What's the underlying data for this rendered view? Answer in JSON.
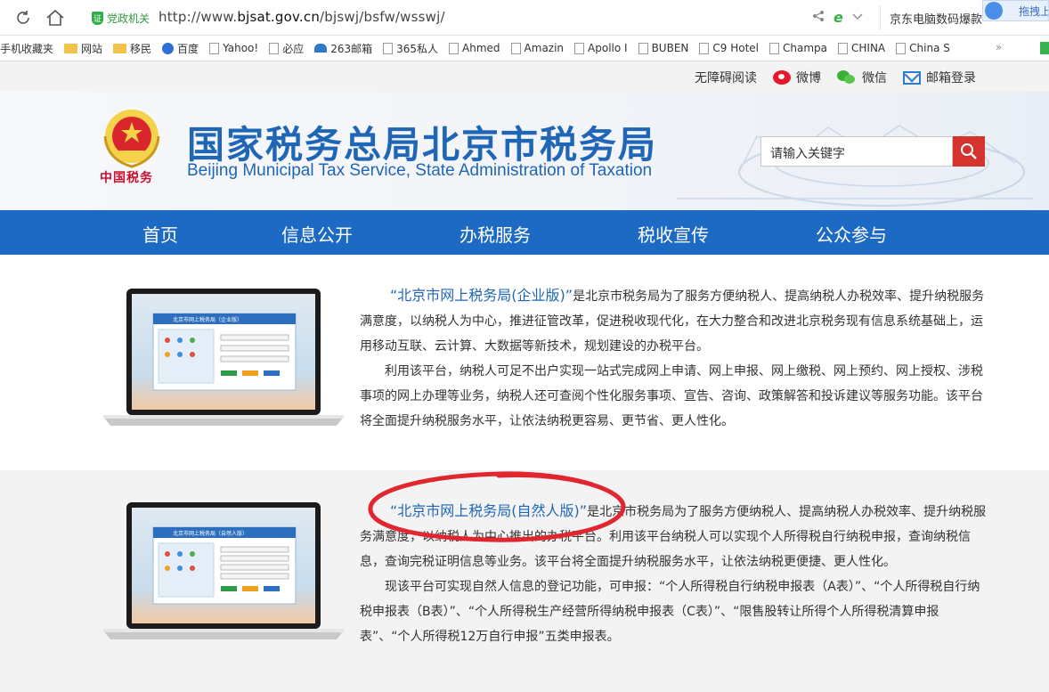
{
  "browser": {
    "site_badge": "党政机关",
    "url_prefix": "http://www.",
    "url_domain": "bjsat.gov.cn",
    "url_path": "/bjswj/bsfw/wsswj/",
    "side_search_text": "京东电脑数码爆款",
    "drag_label": "拖拽上",
    "bookmarks": [
      {
        "label": "手机收藏夹",
        "icon": "none"
      },
      {
        "label": "网站",
        "icon": "folder"
      },
      {
        "label": "移民",
        "icon": "folder"
      },
      {
        "label": "百度",
        "icon": "baidu"
      },
      {
        "label": "Yahoo!",
        "icon": "file"
      },
      {
        "label": "必应",
        "icon": "file"
      },
      {
        "label": "263邮箱",
        "icon": "mail"
      },
      {
        "label": "365私人",
        "icon": "file"
      },
      {
        "label": "Ahmed",
        "icon": "file"
      },
      {
        "label": "Amazin",
        "icon": "file"
      },
      {
        "label": "Apollo I",
        "icon": "file"
      },
      {
        "label": "BUBEN",
        "icon": "file"
      },
      {
        "label": "C9 Hotel",
        "icon": "file"
      },
      {
        "label": "Champa",
        "icon": "file"
      },
      {
        "label": "CHINA",
        "icon": "file"
      },
      {
        "label": "China S",
        "icon": "file"
      }
    ],
    "more": "»"
  },
  "util": {
    "accessible": "无障碍阅读",
    "weibo": "微博",
    "wechat": "微信",
    "mail_login": "邮箱登录"
  },
  "banner": {
    "title": "国家税务总局北京市税务局",
    "subtitle": "Beijing Municipal Tax Service, State Administration of Taxation",
    "emblem_caption": "中国税务",
    "search_placeholder": "请输入关键字"
  },
  "nav": [
    "首页",
    "信息公开",
    "办税服务",
    "税收宣传",
    "公众参与"
  ],
  "sections": [
    {
      "title": "“北京市网上税务局(企业版)”",
      "p1": "是北京市税务局为了服务方便纳税人、提高纳税人办税效率、提升纳税服务满意度，以纳税人为中心，推进征管改革，促进税收现代化，在大力整合和改进北京税务现有信息系统基础上，运用移动互联、云计算、大数据等新技术，规划建设的办税平台。",
      "p2": "利用该平台，纳税人可足不出户实现一站式完成网上申请、网上申报、网上缴税、网上预约、网上授权、涉税事项的网上办理等业务，纳税人还可查阅个性化服务事项、宣告、咨询、政策解答和投诉建议等服务功能。该平台将全面提升纳税服务水平，让依法纳税更容易、更节省、更人性化。",
      "screen_title": "北京市网上税务局（企业版）"
    },
    {
      "title": "“北京市网上税务局(自然人版)”",
      "p1": "是北京市税务局为了服务方便纳税人、提高纳税人办税效率、提升纳税服务满意度，以纳税人为中心推出的办税平台。利用该平台纳税人可以实现个人所得税自行纳税申报，查询纳税信息，查询完税证明信息等业务。该平台将全面提升纳税服务水平，让依法纳税更便捷、更人性化。",
      "p2": "现该平台可实现自然人信息的登记功能，可申报：“个人所得税自行纳税申报表（A表）”、“个人所得税自行纳税申报表（B表）”、“个人所得税生产经营所得纳税申报表（C表）”、“限售股转让所得个人所得税清算申报表”、“个人所得税12万自行申报”五类申报表。",
      "screen_title": "北京市网上税务局（自然人版）"
    }
  ],
  "colors": {
    "brand_blue": "#1d6ac5",
    "search_red": "#d5332e",
    "annotation_red": "#e0262f"
  }
}
